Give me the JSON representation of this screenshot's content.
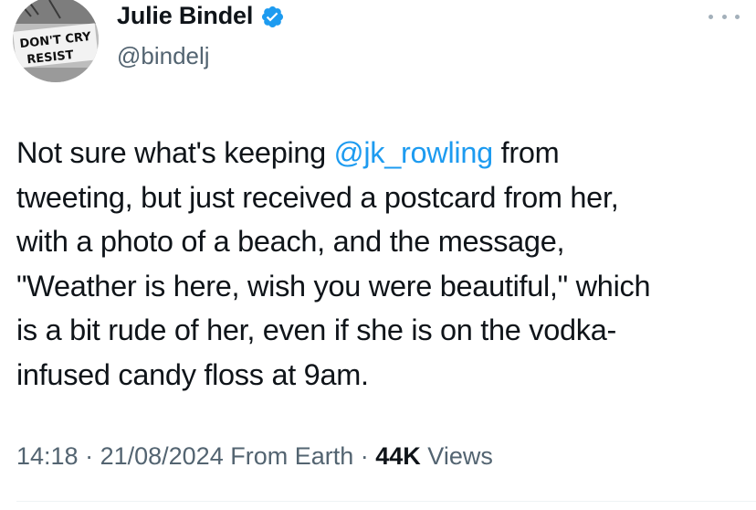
{
  "author": {
    "display_name": "Julie Bindel",
    "handle": "@bindelj",
    "verified": true,
    "avatar_sign_text": [
      "DON'T CRY",
      "RESIST"
    ]
  },
  "tweet": {
    "lines": [
      {
        "before": "Not sure what's keeping ",
        "mention": "@jk_rowling",
        "after": " from"
      },
      {
        "text": "tweeting, but just received a postcard from her,"
      },
      {
        "text": "with a photo of a beach, and the message,"
      },
      {
        "text": "\"Weather is here, wish you were beautiful,\" which"
      },
      {
        "text": "is a bit rude of her, even if she is on the vodka-"
      },
      {
        "text": "infused candy floss at 9am."
      }
    ]
  },
  "meta": {
    "time": "14:18",
    "separator": " · ",
    "date": "21/08/2024",
    "source": "From Earth",
    "views_count": "44K",
    "views_label": " Views"
  },
  "colors": {
    "text": "#0f1419",
    "secondary": "#536471",
    "accent": "#1d9bf0"
  },
  "icons": {
    "verified": "verified-badge-icon",
    "more": "more-options-icon"
  }
}
